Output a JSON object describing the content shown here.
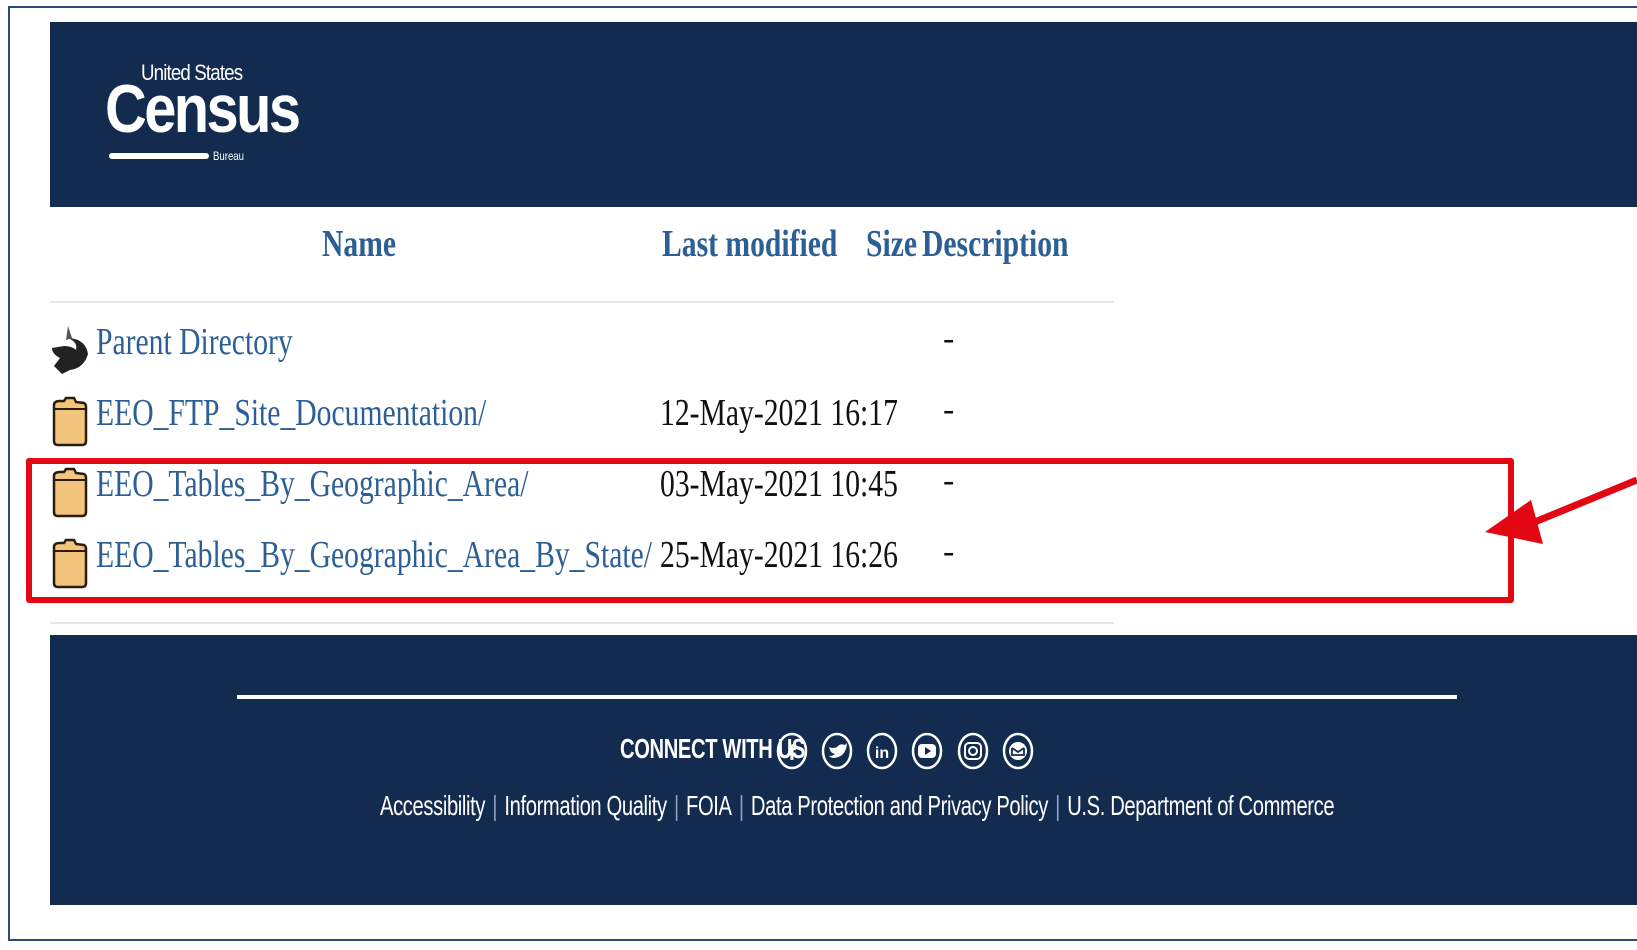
{
  "logo": {
    "top_text": "United States",
    "main_text": "Census",
    "sub_text": "Bureau"
  },
  "table": {
    "headers": {
      "name": "Name",
      "last_modified": "Last modified",
      "size": "Size",
      "description": "Description"
    },
    "rows": [
      {
        "icon": "back-arrow-icon",
        "name": "Parent Directory",
        "modified": "",
        "size": "-"
      },
      {
        "icon": "folder-icon",
        "name": "EEO_FTP_Site_Documentation/",
        "modified": "12-May-2021 16:17",
        "size": "-"
      },
      {
        "icon": "folder-icon",
        "name": "EEO_Tables_By_Geographic_Area/",
        "modified": "03-May-2021 10:45",
        "size": "-"
      },
      {
        "icon": "folder-icon",
        "name": "EEO_Tables_By_Geographic_Area_By_State/",
        "modified": "25-May-2021 16:26",
        "size": "-"
      }
    ]
  },
  "annotation": {
    "highlight_color": "#e30613"
  },
  "footer": {
    "connect_label": "CONNECT WITH US",
    "social_icons": [
      "facebook-icon",
      "twitter-icon",
      "linkedin-icon",
      "youtube-icon",
      "instagram-icon",
      "email-icon"
    ],
    "links": [
      "Accessibility",
      "Information Quality",
      "FOIA",
      "Data Protection and Privacy Policy",
      "U.S. Department of Commerce"
    ]
  },
  "colors": {
    "header_bg": "#132b4f",
    "link": "#2c5f96"
  }
}
